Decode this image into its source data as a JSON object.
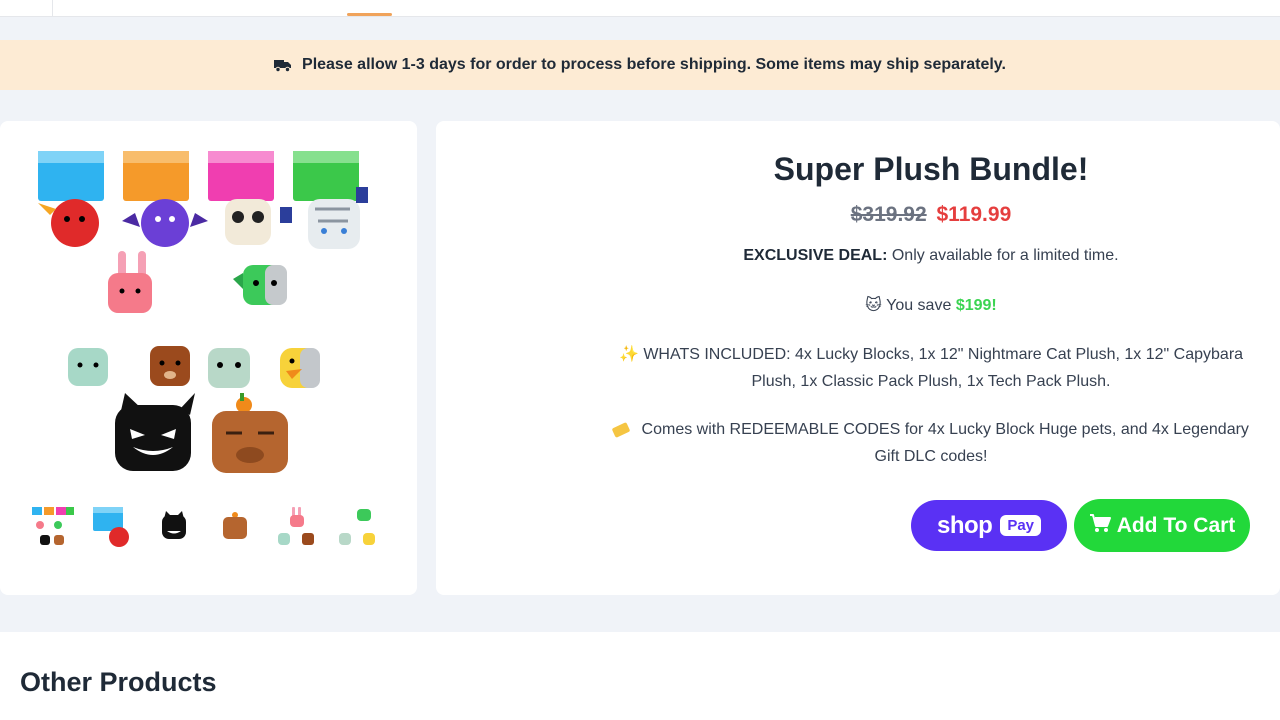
{
  "notice": {
    "icon": "truck-icon",
    "text": "Please allow 1-3 days for order to process before shipping. Some items may ship separately."
  },
  "product": {
    "title": "Super Plush Bundle!",
    "old_price": "$319.92",
    "new_price": "$119.99",
    "deal_label": "EXCLUSIVE DEAL:",
    "deal_text": "Only available for a limited time.",
    "save_icon": "cat-face-emoji-icon",
    "save_text": "You save",
    "save_amount": "$199!",
    "included_icon": "sparkles-icon",
    "included_text": "WHATS INCLUDED: 4x Lucky Blocks, 1x 12\" Nightmare Cat Plush, 1x 12\" Capybara Plush, 1x Classic Pack Plush, 1x Tech Pack Plush.",
    "codes_icon": "ticket-icon",
    "codes_text": "Comes with  REDEEMABLE CODES for 4x Lucky Block Huge pets, and 4x Legendary Gift DLC codes!"
  },
  "buttons": {
    "shop_word": "shop",
    "pay_word": "Pay",
    "add_to_cart": "Add To Cart"
  },
  "colors": {
    "accent_red": "#e53e3e",
    "save_green": "#3bd452",
    "shop_pay_purple": "#5a31f4",
    "cart_green": "#22d83a",
    "notice_bg": "#fdebd4"
  },
  "other_products": {
    "heading": "Other Products"
  }
}
